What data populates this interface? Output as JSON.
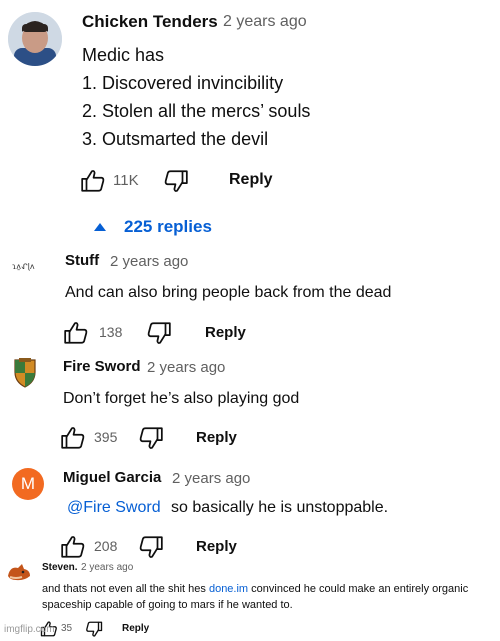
{
  "colors": {
    "link": "#065fd4",
    "secondary_text": "#606060",
    "avatar_m": "#f26a21"
  },
  "comments": [
    {
      "author": "Chicken Tenders",
      "time": "2 years ago",
      "lines": [
        "Medic has",
        "1. Discovered invincibility",
        "2. Stolen all the mercs’ souls",
        "3. Outsmarted the devil"
      ],
      "likes": "11K",
      "reply_label": "Reply",
      "replies_toggle": "225 replies",
      "avatar": "photo"
    },
    {
      "author": "Stuff",
      "time": "2 years ago",
      "text": "And can also bring people back from the dead",
      "likes": "138",
      "reply_label": "Reply",
      "avatar_text": "ɿᴧ̱ᖋɭᴧ"
    },
    {
      "author": "Fire Sword",
      "time": "2 years ago",
      "text": "Don’t forget he’s also playing god",
      "likes": "395",
      "reply_label": "Reply",
      "avatar": "shield"
    },
    {
      "author": "Miguel Garcia",
      "time": "2 years ago",
      "mention": "@Fire Sword",
      "text": "so basically he is unstoppable.",
      "likes": "208",
      "reply_label": "Reply",
      "avatar_letter": "M"
    },
    {
      "author": "Steven.",
      "time": "2 years ago",
      "text_before": "and thats not even all the shit hes ",
      "link": "done.im",
      "text_after": " convinced he could make an entirely organic",
      "text_line2": "spaceship capable of going to mars if he wanted to.",
      "likes": "35",
      "reply_label": "Reply",
      "avatar": "fox"
    }
  ],
  "watermark": "imgflip.com"
}
